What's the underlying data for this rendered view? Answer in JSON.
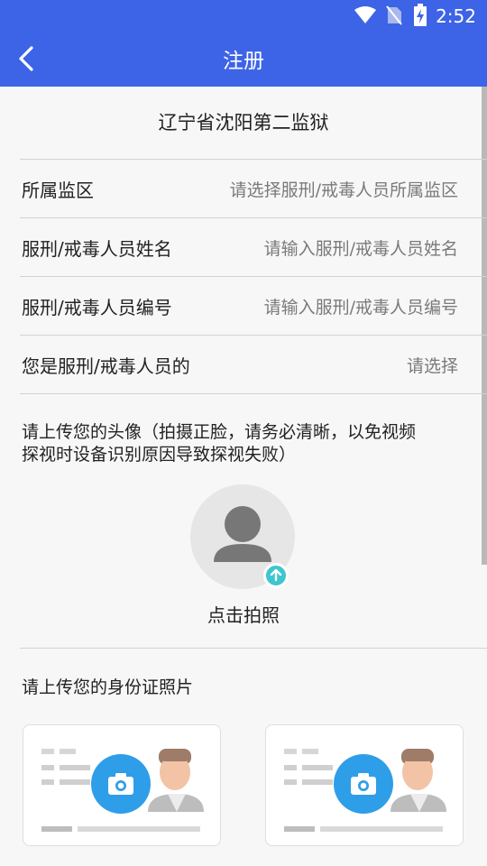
{
  "status_bar": {
    "time": "2:52"
  },
  "header": {
    "title": "注册"
  },
  "prison_name": "辽宁省沈阳第二监狱",
  "form": {
    "rows": [
      {
        "label": "所属监区",
        "placeholder": "请选择服刑/戒毒人员所属监区"
      },
      {
        "label": "服刑/戒毒人员姓名",
        "placeholder": "请输入服刑/戒毒人员姓名"
      },
      {
        "label": "服刑/戒毒人员编号",
        "placeholder": "请输入服刑/戒毒人员编号"
      },
      {
        "label": "您是服刑/戒毒人员的",
        "placeholder": "请选择"
      }
    ]
  },
  "avatar_section": {
    "prompt_line1": "请上传您的头像（拍摄正脸，请务必清晰，以免视频",
    "prompt_line2": "探视时设备识别原因导致探视失败）",
    "take_photo_label": "点击拍照"
  },
  "id_section": {
    "prompt": "请上传您的身份证照片"
  },
  "colors": {
    "primary": "#3d64e6",
    "camera": "#2f9ee8",
    "upload_badge": "#3ec6cf"
  },
  "icons": [
    "wifi-icon",
    "no-sim-icon",
    "battery-charging-icon",
    "back-arrow-icon",
    "avatar-placeholder-icon",
    "upload-arrow-icon",
    "camera-icon"
  ]
}
